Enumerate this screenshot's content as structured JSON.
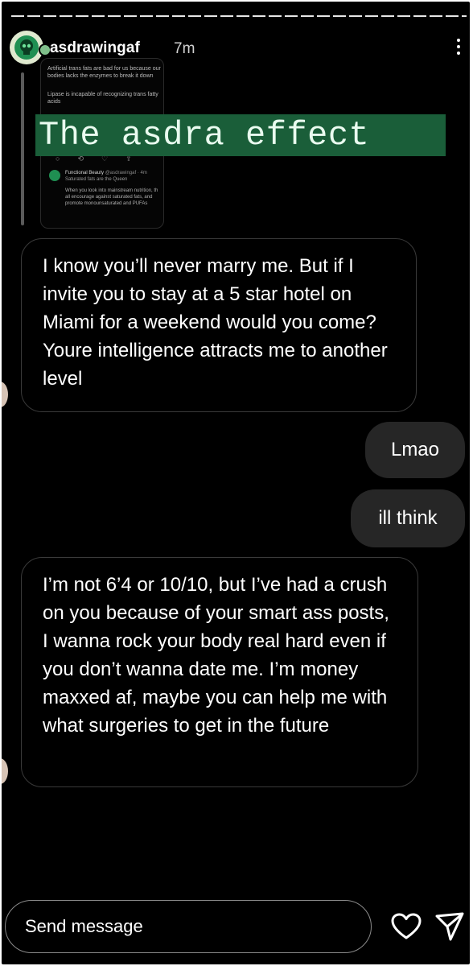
{
  "header": {
    "username": "asdrawingaf",
    "time_ago": "7m"
  },
  "quoted_post": {
    "line1": "Artificial trans fats are bad for us because our",
    "line2": "bodies lacks the enzymes to break it down",
    "line3": "Lipase is incapable of recognizing trans fatty",
    "line4": "acids",
    "reply_name": "Functional Beauty",
    "reply_handle": "@asdrawingaf · 4m",
    "reply_sub": "Saturated fats are the Queen",
    "reply_body": "When you look into mainstream nutrition, th all encourage against saturated fats, and promote monounsaturated and PUFAs"
  },
  "overlay_text": "The asdra effect",
  "messages": [
    {
      "from": "them",
      "text": "I know you’ll never marry me. But if I invite you to stay at a 5 star hotel on Miami for a weekend would you come? Youre intelligence attracts me to another level"
    },
    {
      "from": "me",
      "text": "Lmao"
    },
    {
      "from": "me",
      "text": "ill think"
    },
    {
      "from": "them",
      "text": "I’m not 6’4 or 10/10, but I’ve had a crush on you because of your smart ass posts, I wanna rock your body real hard even if you don’t wanna date me. I’m money maxxed af, maybe you can help me with what surgeries to get in the future"
    }
  ],
  "composer": {
    "placeholder": "Send message"
  },
  "icons": {
    "more": "more-vertical-icon",
    "like": "heart-icon",
    "send": "send-icon"
  },
  "colors": {
    "background": "#000000",
    "my_bubble": "#262626",
    "highlight": "#1a5e39"
  }
}
